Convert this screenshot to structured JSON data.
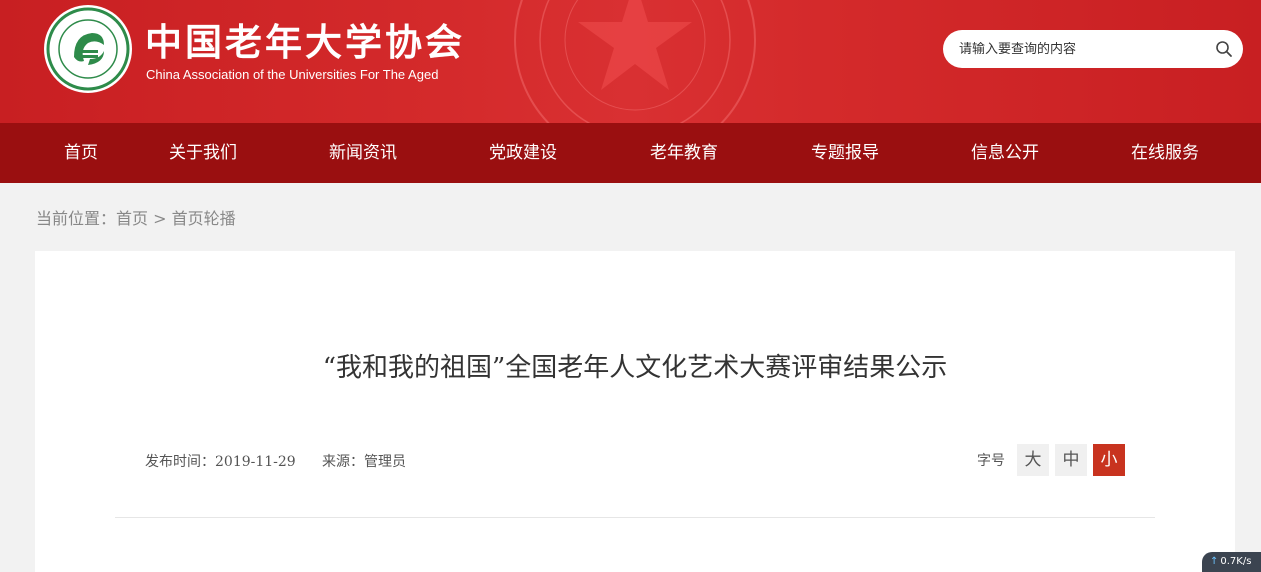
{
  "header": {
    "title": "中国老年大学协会",
    "subtitle": "China Association of the Universities For The Aged",
    "logo_ring_text": "中国老年大学协会"
  },
  "search": {
    "placeholder": "请输入要查询的内容",
    "icon": "search-icon"
  },
  "nav": {
    "items": [
      {
        "label": "首页"
      },
      {
        "label": "关于我们"
      },
      {
        "label": "新闻资讯"
      },
      {
        "label": "党政建设"
      },
      {
        "label": "老年教育"
      },
      {
        "label": "专题报导"
      },
      {
        "label": "信息公开"
      },
      {
        "label": "在线服务"
      }
    ]
  },
  "breadcrumb": {
    "prefix": "当前位置：",
    "home": "首页",
    "separator": " > ",
    "current": "首页轮播"
  },
  "article": {
    "title": "“我和我的祖国”全国老年人文化艺术大赛评审结果公示",
    "publish_label": "发布时间：",
    "publish_date": "2019-11-29",
    "source_label": "来源：",
    "source": "管理员",
    "fontsize_label": "字号",
    "fontsize_options": [
      "大",
      "中",
      "小"
    ],
    "fontsize_selected": "小"
  },
  "speed_widget": {
    "value": "0.7",
    "unit": "K/s"
  },
  "colors": {
    "header_red": "#d42a2b",
    "nav_red": "#9a0f10",
    "active_button": "#c8331f",
    "page_bg": "#f2f2f2",
    "logo_green": "#2e8b4a"
  }
}
